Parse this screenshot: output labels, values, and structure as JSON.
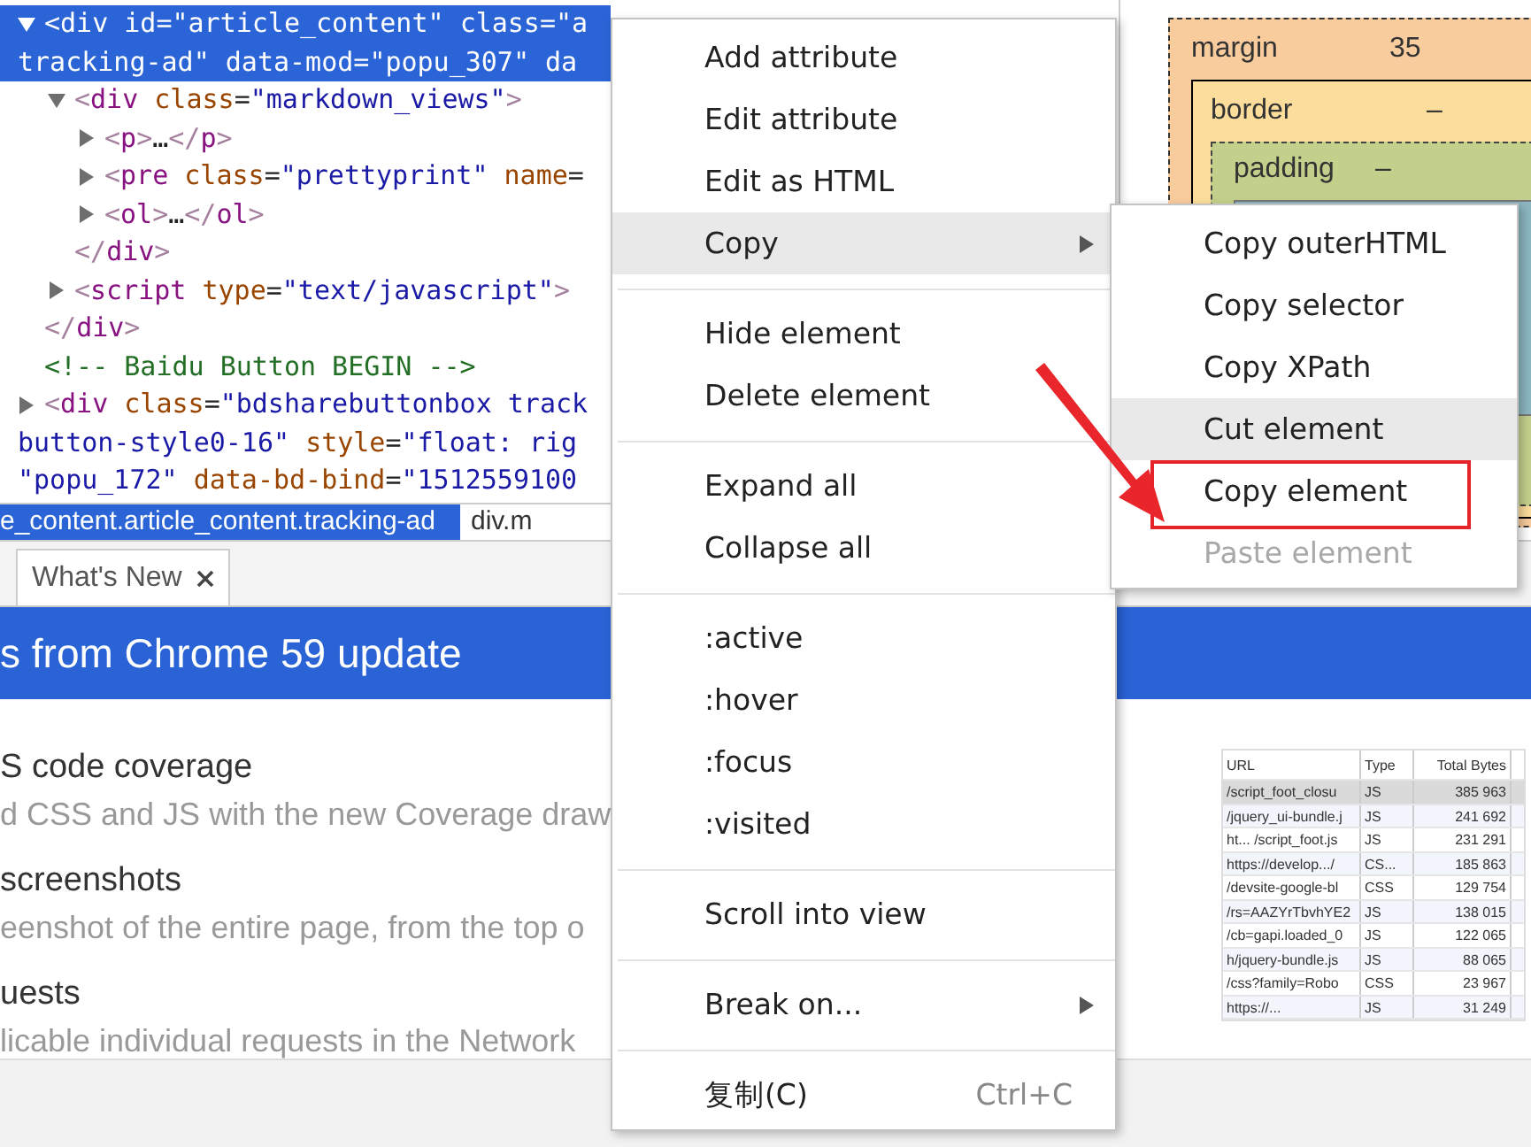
{
  "elements_tree": {
    "nodes": [
      {
        "kind": "element",
        "expanded": true,
        "selected": true,
        "lines": [
          "<div id=\"article_content\" class=\"a",
          "tracking-ad\" data-mod=\"popu_307\" da"
        ],
        "close": "</div>",
        "children": [
          {
            "kind": "element",
            "expanded": true,
            "selected": false,
            "lines": [
              "<div class=\"markdown_views\">"
            ],
            "close": "</div>",
            "children": [
              {
                "kind": "element",
                "expanded": false,
                "selected": false,
                "lines": [
                  "<p>…</p>"
                ]
              },
              {
                "kind": "element",
                "expanded": false,
                "selected": false,
                "lines": [
                  "<pre class=\"prettyprint\" name="
                ]
              },
              {
                "kind": "element",
                "expanded": false,
                "selected": false,
                "lines": [
                  "<ol>…</ol>"
                ]
              }
            ]
          },
          {
            "kind": "element",
            "expanded": false,
            "selected": false,
            "lines": [
              "<script type=\"text/javascript\">"
            ]
          }
        ]
      },
      {
        "kind": "comment",
        "lines": [
          "<!-- Baidu Button BEGIN -->"
        ]
      },
      {
        "kind": "element",
        "expanded": false,
        "selected": false,
        "lines": [
          "<div class=\"bdsharebuttonbox track",
          "button-style0-16\" style=\"float: rig",
          "\"popu_172\" data-bd-bind=\"1512559100"
        ]
      }
    ]
  },
  "breadcrumbs": [
    {
      "label": "e_content.article_content.tracking-ad",
      "selected": true
    },
    {
      "label": "div.m",
      "selected": false
    }
  ],
  "box_model": {
    "margin": {
      "label": "margin",
      "value": "35"
    },
    "border": {
      "label": "border",
      "value": "–"
    },
    "padding": {
      "label": "padding",
      "value": "–"
    }
  },
  "drawer": {
    "tabs": [
      {
        "label": "What's New",
        "selected": true,
        "closable": true
      }
    ],
    "banner": "s from Chrome 59 update",
    "features": [
      {
        "title": "S code coverage",
        "description": "d CSS and JS with the new Coverage draw"
      },
      {
        "title": "screenshots",
        "description": "eenshot of the entire page, from the top o"
      },
      {
        "title": "uests",
        "description": "licable individual requests in the Network"
      }
    ],
    "coverage_table": {
      "columns": [
        "URL",
        "Type",
        "Total Bytes"
      ],
      "rows": [
        {
          "cells": [
            "/script_foot_closu",
            "JS",
            "385 963"
          ],
          "selected": true
        },
        {
          "cells": [
            "/jquery_ui-bundle.j",
            "JS",
            "241 692"
          ],
          "selected": false
        },
        {
          "cells": [
            "ht... /script_foot.js",
            "JS",
            "231 291"
          ],
          "selected": false
        },
        {
          "cells": [
            "https://develop.../",
            "CS...",
            "185 863"
          ],
          "selected": false
        },
        {
          "cells": [
            "/devsite-google-bl",
            "CSS",
            "129 754"
          ],
          "selected": false
        },
        {
          "cells": [
            "/rs=AAZYrTbvhYE2",
            "JS",
            "138 015"
          ],
          "selected": false
        },
        {
          "cells": [
            "/cb=gapi.loaded_0",
            "JS",
            "122 065"
          ],
          "selected": false
        },
        {
          "cells": [
            "h/jquery-bundle.js",
            "JS",
            "88 065"
          ],
          "selected": false
        },
        {
          "cells": [
            "/css?family=Robo",
            "CSS",
            "23 967"
          ],
          "selected": false
        },
        {
          "cells": [
            "https://...",
            "JS",
            "31 249"
          ],
          "selected": false
        }
      ]
    }
  },
  "context_menu": {
    "items": [
      {
        "kind": "item",
        "label": "Add attribute",
        "selected": false,
        "has_submenu": false
      },
      {
        "kind": "item",
        "label": "Edit attribute",
        "selected": false,
        "has_submenu": false
      },
      {
        "kind": "item",
        "label": "Edit as HTML",
        "selected": false,
        "has_submenu": false
      },
      {
        "kind": "item",
        "label": "Copy",
        "selected": true,
        "has_submenu": true
      },
      {
        "kind": "separator"
      },
      {
        "kind": "item",
        "label": "Hide element",
        "selected": false,
        "has_submenu": false
      },
      {
        "kind": "item",
        "label": "Delete element",
        "selected": false,
        "has_submenu": false
      },
      {
        "kind": "separator"
      },
      {
        "kind": "item",
        "label": "Expand all",
        "selected": false,
        "has_submenu": false
      },
      {
        "kind": "item",
        "label": "Collapse all",
        "selected": false,
        "has_submenu": false
      },
      {
        "kind": "separator"
      },
      {
        "kind": "item",
        "label": ":active",
        "selected": false,
        "has_submenu": false
      },
      {
        "kind": "item",
        "label": ":hover",
        "selected": false,
        "has_submenu": false
      },
      {
        "kind": "item",
        "label": ":focus",
        "selected": false,
        "has_submenu": false
      },
      {
        "kind": "item",
        "label": ":visited",
        "selected": false,
        "has_submenu": false
      },
      {
        "kind": "separator"
      },
      {
        "kind": "item",
        "label": "Scroll into view",
        "selected": false,
        "has_submenu": false
      },
      {
        "kind": "separator"
      },
      {
        "kind": "item",
        "label": "Break on...",
        "selected": false,
        "has_submenu": true
      },
      {
        "kind": "separator"
      },
      {
        "kind": "item",
        "label": "复制(C)",
        "shortcut": "Ctrl+C",
        "selected": false,
        "has_submenu": false
      }
    ]
  },
  "submenu": {
    "items": [
      {
        "label": "Copy outerHTML",
        "selected": false,
        "disabled": false,
        "marked": false
      },
      {
        "label": "Copy selector",
        "selected": false,
        "disabled": false,
        "marked": false
      },
      {
        "label": "Copy XPath",
        "selected": false,
        "disabled": false,
        "marked": false
      },
      {
        "label": "Cut element",
        "selected": true,
        "disabled": false,
        "marked": false
      },
      {
        "label": "Copy element",
        "selected": false,
        "disabled": false,
        "marked": true
      },
      {
        "label": "Paste element",
        "selected": false,
        "disabled": true,
        "marked": false
      }
    ]
  }
}
